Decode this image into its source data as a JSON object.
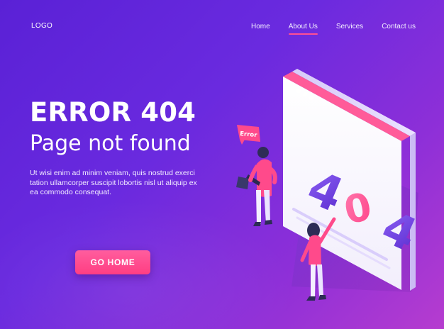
{
  "header": {
    "logo": "LOGO",
    "nav": [
      {
        "label": "Home"
      },
      {
        "label": "About Us",
        "active": true
      },
      {
        "label": "Services"
      },
      {
        "label": "Contact us"
      }
    ]
  },
  "hero": {
    "title": "ERROR 404",
    "subtitle": "Page not found",
    "body": "Ut wisi enim ad minim veniam, quis nostrud exerci tation ullamcorper suscipit lobortis nisl ut aliquip ex ea commodo consequat.",
    "button_label": "GO HOME"
  },
  "illustration": {
    "error_tag": "Error",
    "digits": [
      "4",
      "0",
      "4"
    ]
  },
  "colors": {
    "background_start": "#5a21d6",
    "background_end": "#b63ccf",
    "accent_pink": "#ff4f93",
    "button_pink": "#ff4a8b",
    "digit_purple": "#6e3ee0",
    "window_white": "#ffffff"
  }
}
